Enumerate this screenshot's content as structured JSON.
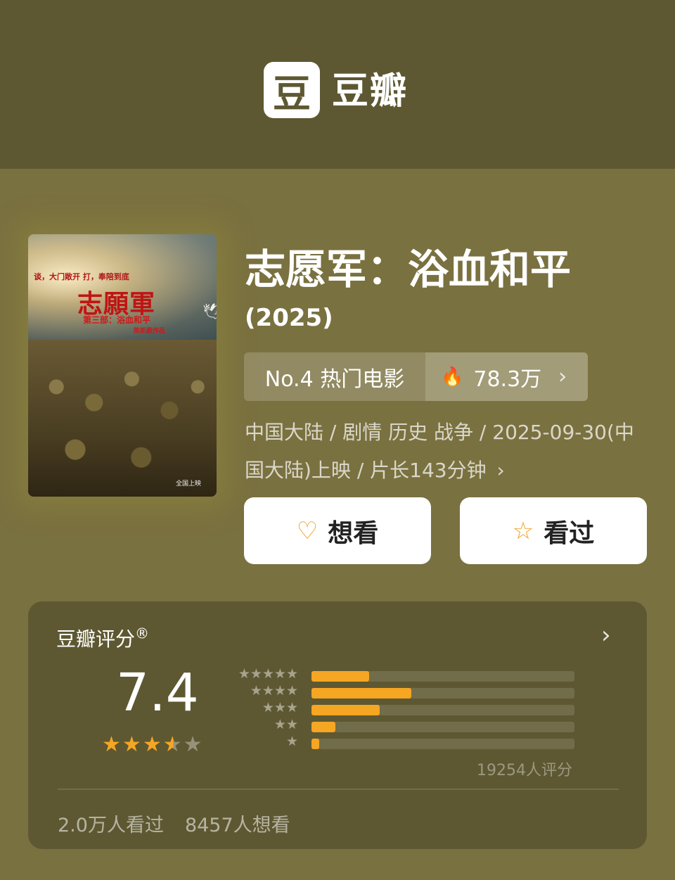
{
  "header": {
    "logo_char": "豆",
    "brand": "豆瓣"
  },
  "movie": {
    "title": "志愿军：浴血和平",
    "year": "(2025)",
    "rank_label": "No.4 热门电影",
    "heat_value": "78.3万",
    "meta_text": "中国大陆 / 剧情 历史 战争 / 2025-09-30(中国大陆)上映 / 片长143分钟",
    "poster": {
      "tagline": "谈，大门敞开   打，奉陪到底",
      "title": "志願軍",
      "subtitle": "第三部：浴血和平",
      "director": "陈凯歌作品",
      "release": "全国上映"
    }
  },
  "actions": {
    "want_label": "想看",
    "seen_label": "看过"
  },
  "rating": {
    "label": "豆瓣评分",
    "registered": "®",
    "score": "7.4",
    "star_value": 3.5,
    "distribution": [
      {
        "stars": 5,
        "label": "★★★★★",
        "fraction": 0.22
      },
      {
        "stars": 4,
        "label": "★★★★",
        "fraction": 0.38
      },
      {
        "stars": 3,
        "label": "★★★",
        "fraction": 0.26
      },
      {
        "stars": 2,
        "label": "★★",
        "fraction": 0.09
      },
      {
        "stars": 1,
        "label": "★",
        "fraction": 0.03
      }
    ],
    "count_text": "19254人评分",
    "seen_count": "2.0万人看过",
    "want_count": "8457人想看"
  },
  "icons": {
    "fire": "fire-icon",
    "heart_plus": "heart-plus-icon",
    "star_outline": "star-outline-icon",
    "chevron": "chevron-right-icon"
  },
  "colors": {
    "page_bg": "#7a7140",
    "header_bg": "#5e5832",
    "accent": "#f5a623",
    "button_bg": "#ffffff"
  }
}
